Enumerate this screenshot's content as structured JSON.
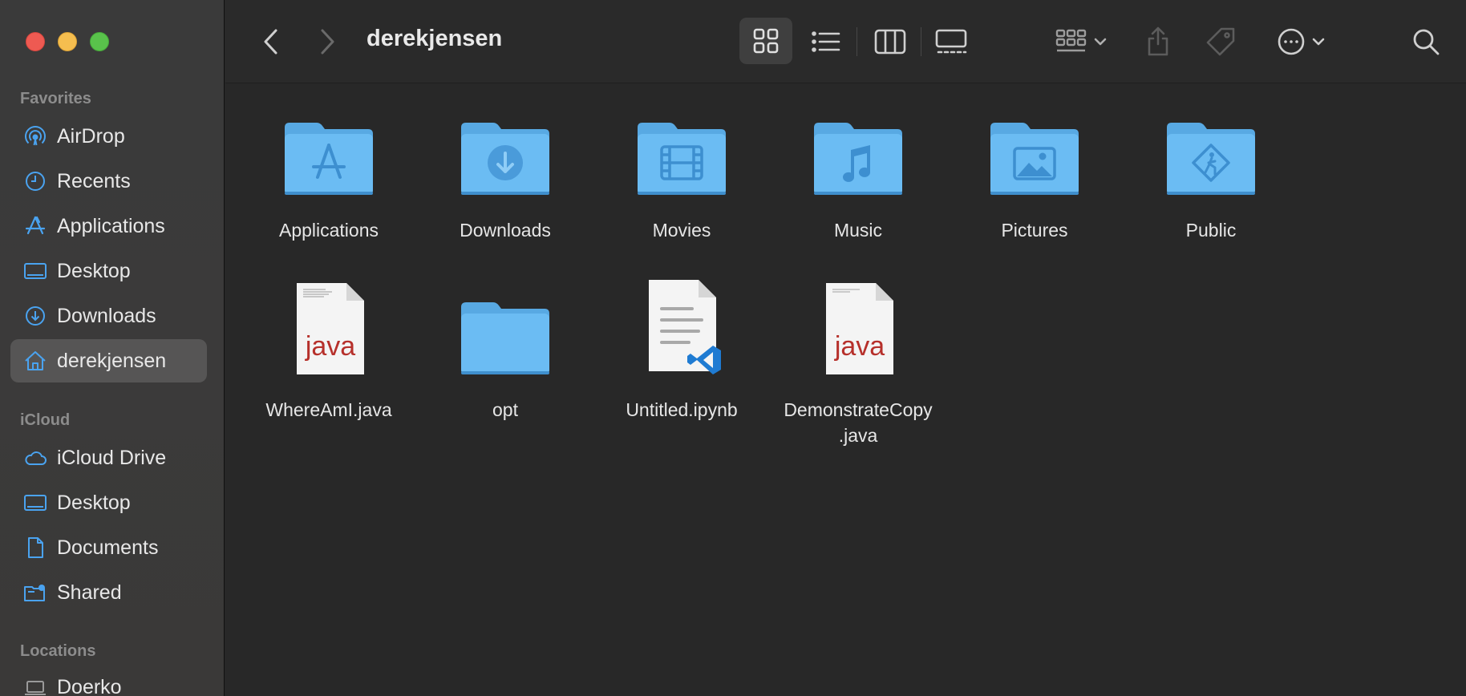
{
  "window": {
    "title": "derekjensen"
  },
  "sidebar": {
    "sections": [
      {
        "heading": "Favorites"
      },
      {
        "heading": "iCloud"
      },
      {
        "heading": "Locations"
      }
    ],
    "favorites": [
      {
        "label": "AirDrop",
        "icon": "airdrop-icon"
      },
      {
        "label": "Recents",
        "icon": "clock-icon"
      },
      {
        "label": "Applications",
        "icon": "applications-icon"
      },
      {
        "label": "Desktop",
        "icon": "desktop-icon"
      },
      {
        "label": "Downloads",
        "icon": "download-icon"
      },
      {
        "label": "derekjensen",
        "icon": "home-icon",
        "selected": true
      }
    ],
    "icloud": [
      {
        "label": "iCloud Drive",
        "icon": "cloud-icon"
      },
      {
        "label": "Desktop",
        "icon": "desktop-icon"
      },
      {
        "label": "Documents",
        "icon": "document-icon"
      },
      {
        "label": "Shared",
        "icon": "shared-folder-icon"
      }
    ],
    "locations": [
      {
        "label": "Doerko",
        "icon": "laptop-icon"
      }
    ]
  },
  "toolbar": {
    "view_mode": "icon",
    "buttons": [
      "back",
      "forward",
      "icon-view",
      "list-view",
      "column-view",
      "gallery-view",
      "group",
      "share",
      "tags",
      "more",
      "search"
    ]
  },
  "items": [
    {
      "name": "Applications",
      "kind": "folder",
      "glyph": "applications"
    },
    {
      "name": "Downloads",
      "kind": "folder",
      "glyph": "download"
    },
    {
      "name": "Movies",
      "kind": "folder",
      "glyph": "film"
    },
    {
      "name": "Music",
      "kind": "folder",
      "glyph": "music"
    },
    {
      "name": "Pictures",
      "kind": "folder",
      "glyph": "picture"
    },
    {
      "name": "Public",
      "kind": "folder",
      "glyph": "public"
    },
    {
      "name": "WhereAmI.java",
      "kind": "java"
    },
    {
      "name": "opt",
      "kind": "folder",
      "glyph": ""
    },
    {
      "name": "Untitled.ipynb",
      "kind": "ipynb"
    },
    {
      "name": "DemonstrateCopy",
      "name2": ".java",
      "kind": "java"
    }
  ],
  "labels": {
    "java": "java"
  },
  "colors": {
    "accent": "#4aa3f0",
    "folder": "#6bbcf3",
    "folder_tab": "#58a9e3",
    "java_text": "#b6302b"
  }
}
